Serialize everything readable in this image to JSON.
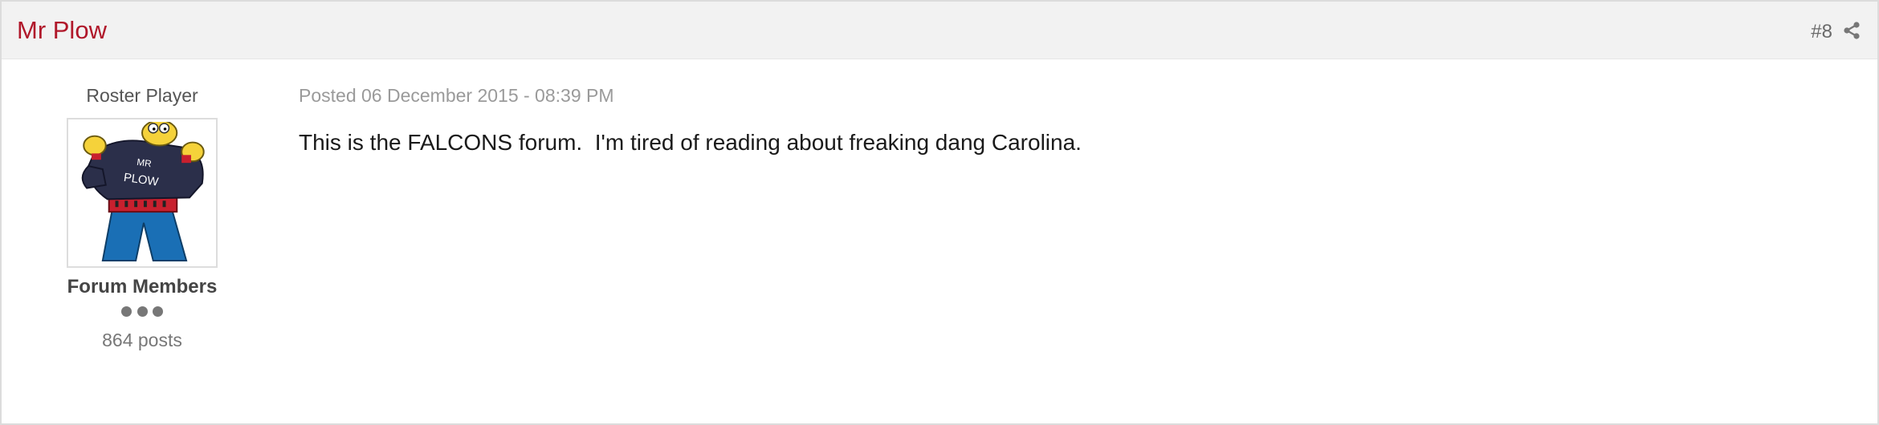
{
  "header": {
    "author_name": "Mr Plow",
    "post_number": "#8"
  },
  "author": {
    "member_title": "Roster Player",
    "avatar_caption": "MR PLOW",
    "group": "Forum Members",
    "rank_pips": 3,
    "post_count": "864 posts"
  },
  "post": {
    "date": "Posted 06 December 2015 - 08:39 PM",
    "text": "This is the FALCONS forum.  I'm tired of reading about freaking dang Carolina."
  },
  "colors": {
    "author_name": "#b0172a",
    "header_bg": "#f2f2f2",
    "jacket": "#2b2f4a",
    "pants": "#1a6fb5",
    "belt": "#c8202e"
  },
  "icons": {
    "share": "share-icon",
    "avatar_rank": "rank-pip-icon"
  }
}
